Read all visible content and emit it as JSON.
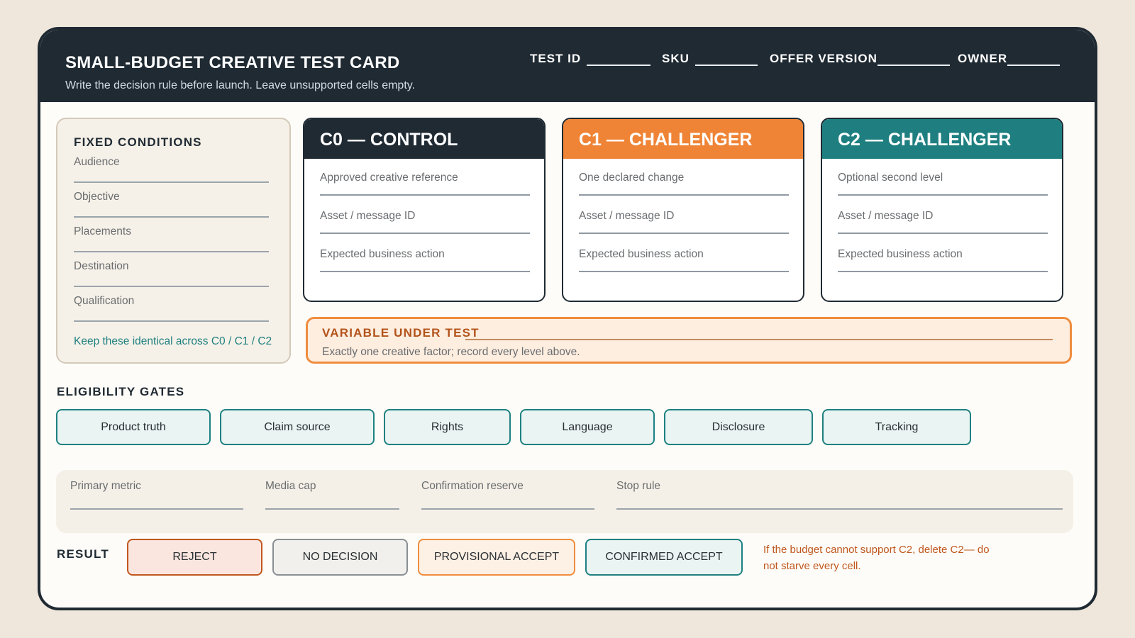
{
  "header": {
    "title": "SMALL-BUDGET CREATIVE TEST CARD",
    "subtitle": "Write the decision rule before launch. Leave unsupported cells empty.",
    "fields": [
      "TEST ID",
      "SKU",
      "OFFER VERSION",
      "OWNER"
    ]
  },
  "fixed_conditions": {
    "title": "FIXED CONDITIONS",
    "items": [
      "Audience",
      "Objective",
      "Placements",
      "Destination",
      "Qualification"
    ],
    "note": "Keep these identical across C0 / C1 / C2"
  },
  "concepts": [
    {
      "title": "C0 — CONTROL",
      "color": "#1f2a33",
      "rows": [
        "Approved creative reference",
        "Asset / message ID",
        "Expected business action"
      ]
    },
    {
      "title": "C1 — CHALLENGER",
      "color": "#ef8436",
      "rows": [
        "One declared change",
        "Asset / message ID",
        "Expected business action"
      ]
    },
    {
      "title": "C2 — CHALLENGER",
      "color": "#1f7f80",
      "rows": [
        "Optional second level",
        "Asset / message ID",
        "Expected business action"
      ]
    }
  ],
  "variable": {
    "label": "VARIABLE UNDER TEST",
    "note": "Exactly one creative factor; record every level above."
  },
  "gates": {
    "title": "ELIGIBILITY GATES",
    "items": [
      "Product truth",
      "Claim source",
      "Rights",
      "Language",
      "Disclosure",
      "Tracking"
    ]
  },
  "metrics": [
    "Primary metric",
    "Media cap",
    "Confirmation reserve",
    "Stop rule"
  ],
  "result": {
    "label": "RESULT",
    "options": [
      "REJECT",
      "NO DECISION",
      "PROVISIONAL ACCEPT",
      "CONFIRMED ACCEPT"
    ],
    "note": "If the budget cannot support C2, delete C2— do not starve every cell."
  }
}
